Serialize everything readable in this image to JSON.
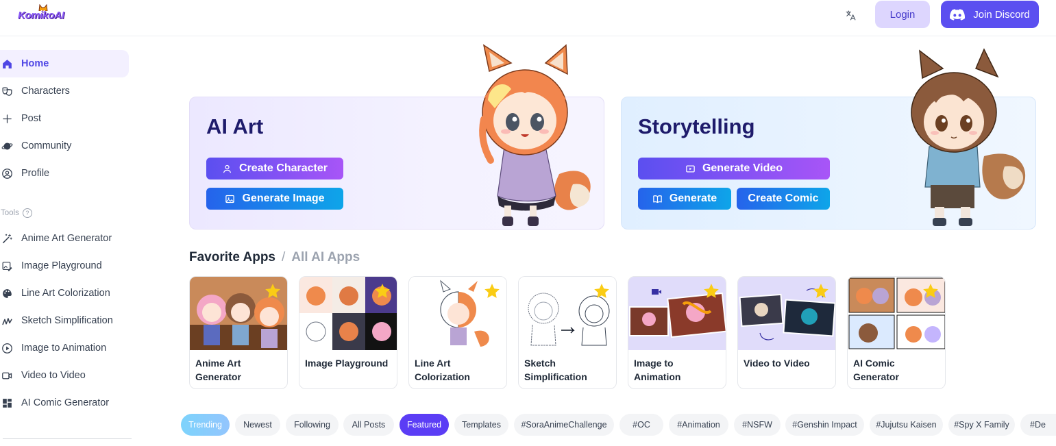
{
  "header": {
    "logo_text": "KomikoAI",
    "language_icon": "translate-icon",
    "login_label": "Login",
    "discord_label": "Join Discord",
    "discord_icon": "discord-icon"
  },
  "sidebar": {
    "items": [
      {
        "label": "Home",
        "icon": "home-icon",
        "active": true
      },
      {
        "label": "Characters",
        "icon": "masks-icon"
      },
      {
        "label": "Post",
        "icon": "plus-icon"
      },
      {
        "label": "Community",
        "icon": "planet-icon"
      },
      {
        "label": "Profile",
        "icon": "user-circle-icon"
      }
    ],
    "tools_label": "Tools",
    "tools": [
      {
        "label": "Anime Art Generator",
        "icon": "magic-wand-icon"
      },
      {
        "label": "Image Playground",
        "icon": "image-edit-icon"
      },
      {
        "label": "Line Art Colorization",
        "icon": "palette-icon"
      },
      {
        "label": "Sketch Simplification",
        "icon": "scribble-icon"
      },
      {
        "label": "Image to Animation",
        "icon": "play-circle-icon"
      },
      {
        "label": "Video to Video",
        "icon": "video-icon"
      },
      {
        "label": "AI Comic Generator",
        "icon": "comic-grid-icon"
      }
    ]
  },
  "hero": {
    "art": {
      "title": "AI Art",
      "create_character": "Create Character",
      "generate_image": "Generate Image"
    },
    "story": {
      "title": "Storytelling",
      "generate_video": "Generate Video",
      "generate": "Generate",
      "create_comic": "Create Comic"
    }
  },
  "apps": {
    "favorite_label": "Favorite Apps",
    "separator": "/",
    "all_label": "All AI Apps",
    "items": [
      {
        "label": "Anime Art Generator"
      },
      {
        "label": "Image Playground"
      },
      {
        "label": "Line Art Colorization"
      },
      {
        "label": "Sketch Simplification"
      },
      {
        "label": "Image to Animation"
      },
      {
        "label": "Video to Video"
      },
      {
        "label": "AI Comic Generator"
      }
    ]
  },
  "filters": [
    "Trending",
    "Newest",
    "Following",
    "All Posts",
    "Featured",
    "Templates",
    "#SoraAnimeChallenge",
    "#OC",
    "#Animation",
    "#NSFW",
    "#Genshin Impact",
    "#Jujutsu Kaisen",
    "#Spy X Family",
    "#De"
  ],
  "colors": {
    "accent": "#5b4ff0",
    "accent_light": "#ddd6fe",
    "star": "#facc15"
  }
}
